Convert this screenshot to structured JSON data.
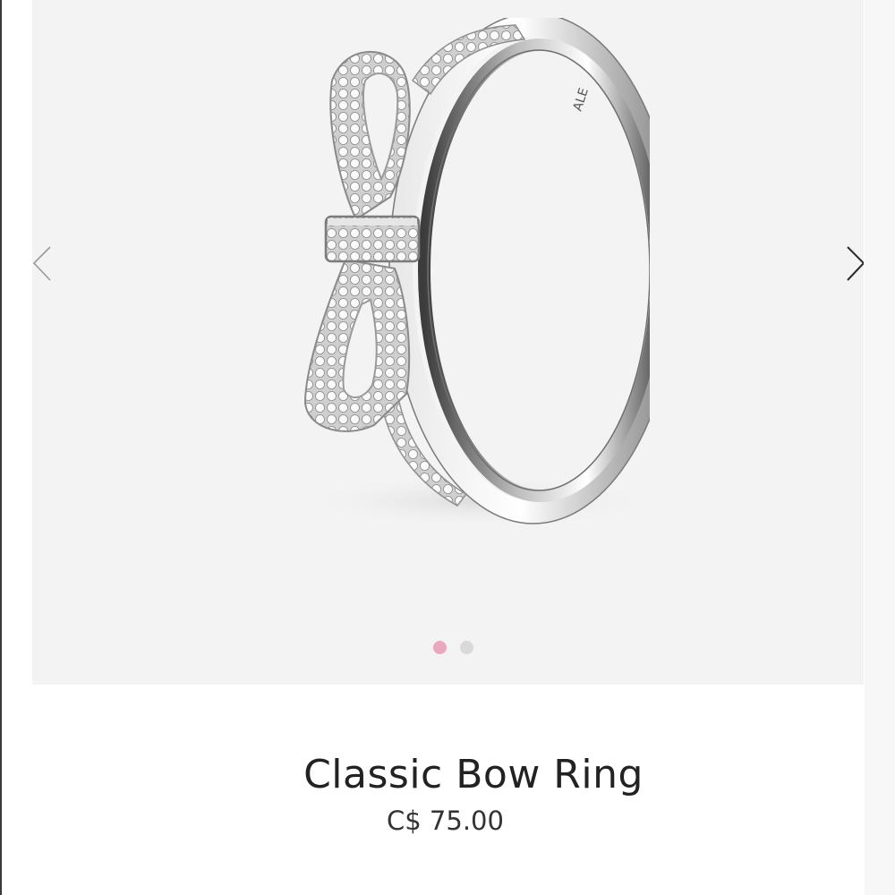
{
  "gallery": {
    "image_alt": "Classic Bow Ring product image",
    "ring_engraving": "ALE",
    "slide_count": 2,
    "active_slide": 1,
    "colors": {
      "background": "#f3f3f3",
      "active_dot": "#eba8bd",
      "inactive_dot": "#d9d9d9"
    }
  },
  "product": {
    "title": "Classic Bow Ring",
    "price": "C$ 75.00"
  }
}
